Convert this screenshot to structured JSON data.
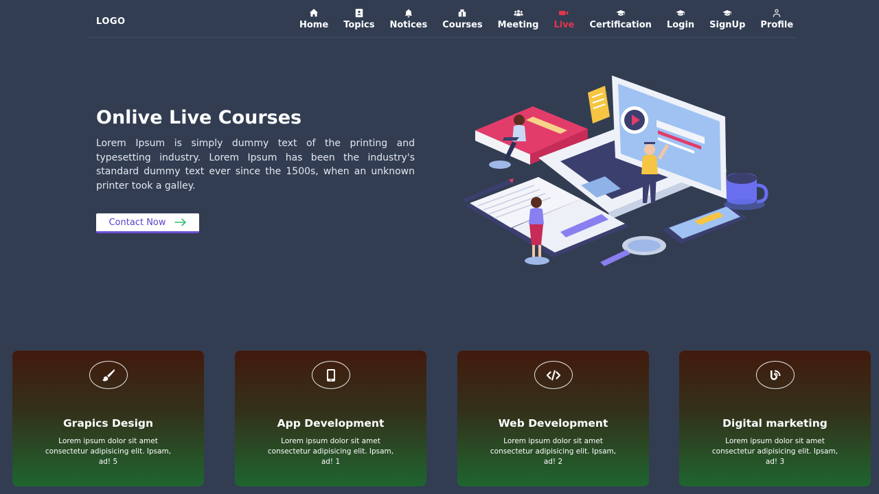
{
  "navbar": {
    "logo": "LOGO",
    "items": [
      {
        "label": "Home",
        "icon": "home-icon",
        "active": false
      },
      {
        "label": "Topics",
        "icon": "address-book-icon",
        "active": false
      },
      {
        "label": "Notices",
        "icon": "bell-icon",
        "active": false
      },
      {
        "label": "Courses",
        "icon": "books-icon",
        "active": false
      },
      {
        "label": "Meeting",
        "icon": "users-icon",
        "active": false
      },
      {
        "label": "Live",
        "icon": "video-icon",
        "active": true
      },
      {
        "label": "Certification",
        "icon": "graduation-cap-icon",
        "active": false
      },
      {
        "label": "Login",
        "icon": "graduation-cap-icon",
        "active": false
      },
      {
        "label": "SignUp",
        "icon": "graduation-cap-icon",
        "active": false
      },
      {
        "label": "Profile",
        "icon": "user-icon",
        "active": false
      }
    ]
  },
  "hero": {
    "title": "Onlive Live Courses",
    "text": "Lorem Ipsum is simply dummy text of the printing and typesetting industry. Lorem Ipsum has been the industry's standard dummy text ever since the 1500s, when an unknown printer took a galley.",
    "button_label": "Contact Now",
    "button_icon": "arrow-right-icon"
  },
  "cards": [
    {
      "title": "Grapics Design",
      "text": "Lorem ipsum dolor sit amet consectetur adipisicing elit. Ipsam, ad! 5",
      "icon": "paint-brush-icon"
    },
    {
      "title": "App Development",
      "text": "Lorem ipsum dolor sit amet consectetur adipisicing elit. Ipsam, ad! 1",
      "icon": "mobile-icon"
    },
    {
      "title": "Web Development",
      "text": "Lorem ipsum dolor sit amet consectetur adipisicing elit. Ipsam, ad! 2",
      "icon": "code-icon"
    },
    {
      "title": "Digital marketing",
      "text": "Lorem ipsum dolor sit amet consectetur adipisicing elit. Ipsam, ad! 3",
      "icon": "blogger-icon"
    }
  ],
  "colors": {
    "background": "#323d52",
    "active_nav": "#e5354b",
    "button_text": "#5b3fc9",
    "card_gradient_top": "#421a0d",
    "card_gradient_bottom": "#1f6530"
  }
}
